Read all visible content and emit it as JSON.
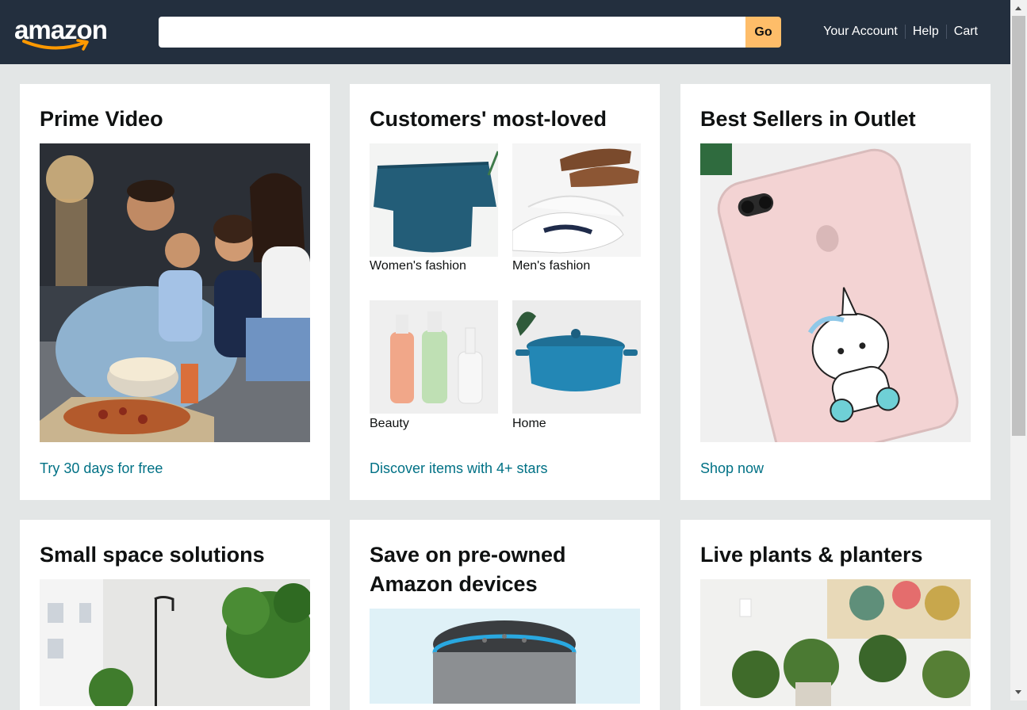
{
  "header": {
    "logo_text": "amazon",
    "search": {
      "value": "",
      "placeholder": ""
    },
    "go_label": "Go",
    "nav": [
      "Your Account",
      "Help",
      "Cart"
    ]
  },
  "cards": {
    "prime": {
      "title": "Prime Video",
      "link": "Try 30 days for free"
    },
    "loved": {
      "title": "Customers' most-loved",
      "items": [
        "Women's fashion",
        "Men's fashion",
        "Beauty",
        "Home"
      ],
      "link": "Discover items with 4+ stars"
    },
    "outlet": {
      "title": "Best Sellers in Outlet",
      "link": "Shop now"
    },
    "small_space": {
      "title": "Small space solutions"
    },
    "preowned": {
      "title": "Save on pre-owned Amazon devices"
    },
    "plants": {
      "title": "Live plants & planters"
    }
  },
  "colors": {
    "header_bg": "#232f3e",
    "page_bg": "#e3e6e6",
    "go_button": "#febd69",
    "link": "#007185",
    "logo_smile": "#ff9900"
  }
}
